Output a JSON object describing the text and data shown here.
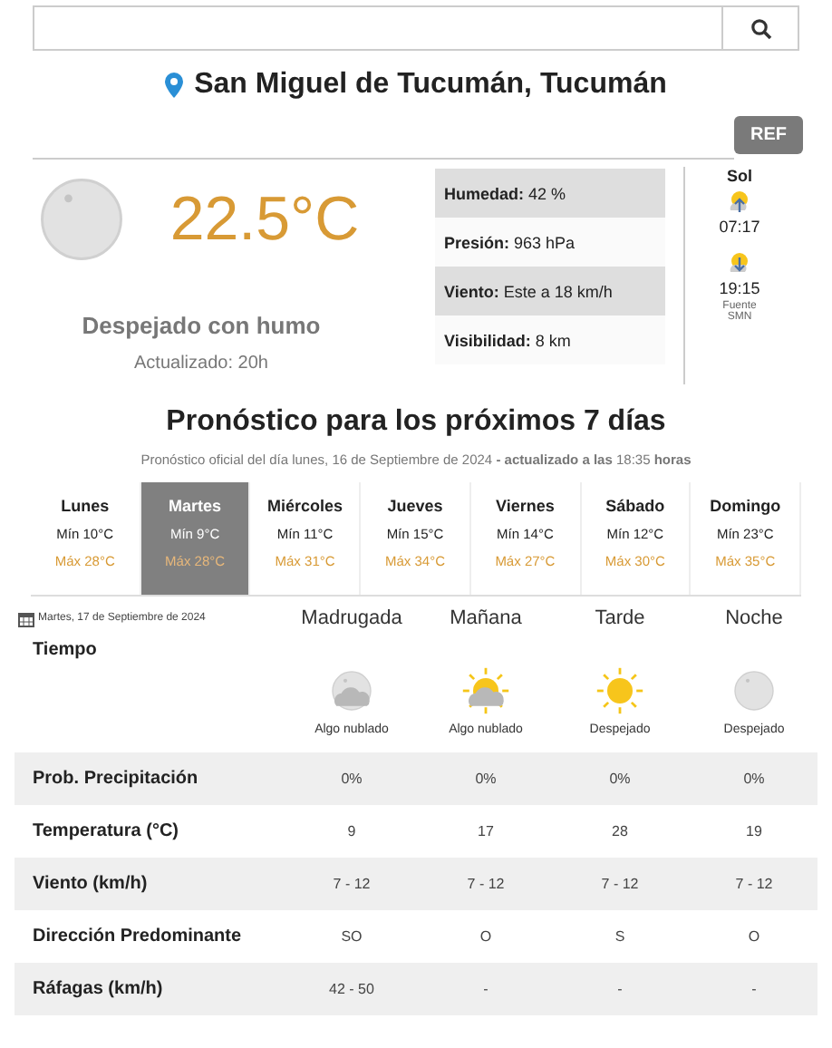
{
  "location": "San Miguel de Tucumán, Tucumán",
  "ref_button": "REF",
  "current": {
    "kind": "moon",
    "temperature": "22.5°C",
    "condition": "Despejado con humo",
    "updated": "Actualizado: 20h"
  },
  "details": [
    "**Humedad:** 42 %",
    "**Presión:** 963 hPa",
    "**Viento:** Este a 18 km/h",
    "**Visibilidad:** 8 km"
  ],
  "sun": {
    "title": "Sol",
    "sunrise": "07:17",
    "sunset": "19:15",
    "source": "Fuente SMN"
  },
  "forecast_title": "Pronóstico para los próximos 7 días",
  "forecast_subtitle": "Pronóstico oficial del día lunes, 16 de Septiembre de 2024 **- actualizado a las** 18:35 **horas**",
  "days": [
    {
      "name": "Lunes",
      "min": "Mín 10°C",
      "max": "Máx 28°C",
      "selected": false
    },
    {
      "name": "Martes",
      "min": "Mín 9°C",
      "max": "Máx 28°C",
      "selected": true
    },
    {
      "name": "Miércoles",
      "min": "Mín 11°C",
      "max": "Máx 31°C",
      "selected": false
    },
    {
      "name": "Jueves",
      "min": "Mín 15°C",
      "max": "Máx 34°C",
      "selected": false
    },
    {
      "name": "Viernes",
      "min": "Mín 14°C",
      "max": "Máx 27°C",
      "selected": false
    },
    {
      "name": "Sábado",
      "min": "Mín 12°C",
      "max": "Máx 30°C",
      "selected": false
    },
    {
      "name": "Domingo",
      "min": "Mín 23°C",
      "max": "Máx 35°C",
      "selected": false
    }
  ],
  "detail": {
    "date": "Martes, 17 de Septiembre de 2024",
    "weather_label": "Tiempo",
    "periods": [
      {
        "name": "Madrugada",
        "kind": "moon-cloud",
        "condition": "Algo nublado"
      },
      {
        "name": "Mañana",
        "kind": "sun-cloud",
        "condition": "Algo nublado"
      },
      {
        "name": "Tarde",
        "kind": "sun",
        "condition": "Despejado"
      },
      {
        "name": "Noche",
        "kind": "moon",
        "condition": "Despejado"
      }
    ],
    "rows": [
      {
        "label": "Prob. Precipitación",
        "values": [
          "0%",
          "0%",
          "0%",
          "0%"
        ]
      },
      {
        "label": "Temperatura (°C)",
        "values": [
          "9",
          "17",
          "28",
          "19"
        ]
      },
      {
        "label": "Viento (km/h)",
        "values": [
          "7 - 12",
          "7 - 12",
          "7 - 12",
          "7 - 12"
        ]
      },
      {
        "label": "Dirección Predominante",
        "values": [
          "SO",
          "O",
          "S",
          "O"
        ]
      },
      {
        "label": "Ráfagas (km/h)",
        "values": [
          "42 - 50",
          "-",
          "-",
          "-"
        ]
      }
    ]
  }
}
